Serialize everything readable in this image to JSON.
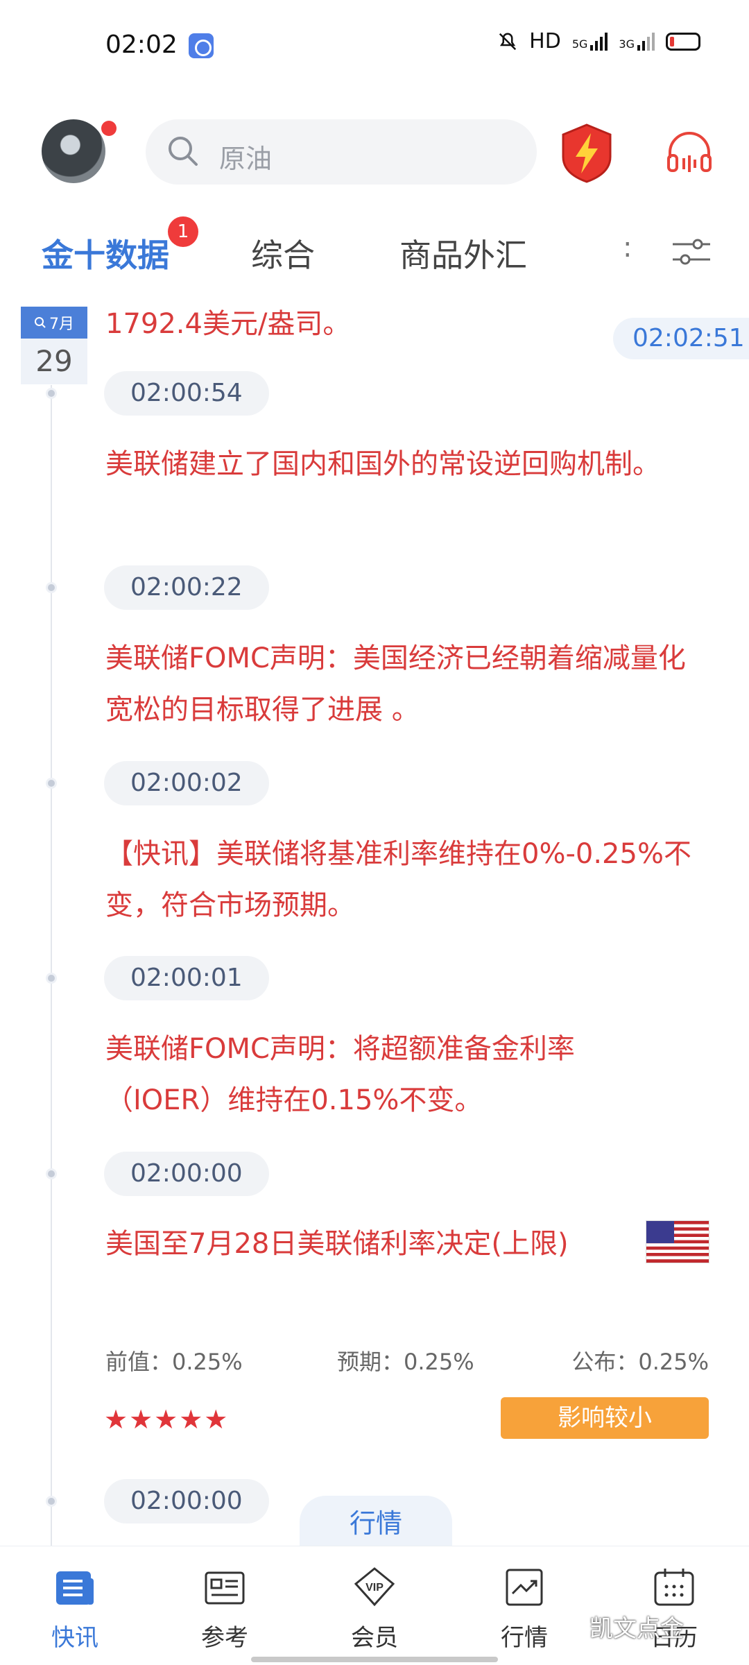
{
  "status_bar": {
    "time": "02:02",
    "network_text": "HD",
    "gen1": "5G",
    "gen2": "3G"
  },
  "header": {
    "search_placeholder": "原油"
  },
  "tabs": [
    {
      "label": "金十数据",
      "badge": "1"
    },
    {
      "label": "综合"
    },
    {
      "label": "商品外汇"
    }
  ],
  "tab_more": ":",
  "date": {
    "month": "7月",
    "day": "29"
  },
  "float_time": "02:02:51",
  "partial_text": "1792.4美元/盎司。",
  "feed": [
    {
      "time": "02:00:54",
      "text": "美联储建立了国内和国外的常设逆回购机制。"
    },
    {
      "time": "02:00:22",
      "text": "美联储FOMC声明：美国经济已经朝着缩减量化宽松的目标取得了进展 。"
    },
    {
      "time": "02:00:02",
      "text": "【快讯】美联储将基准利率维持在0%-0.25%不变，符合市场预期。"
    },
    {
      "time": "02:00:01",
      "text": "美联储FOMC声明：将超额准备金利率（IOER）维持在0.15%不变。"
    },
    {
      "time": "02:00:00",
      "text": "美国至7月28日美联储利率决定(上限)",
      "flag": "us-flag",
      "previous": "前值：0.25%",
      "forecast": "预期：0.25%",
      "actual": "公布：0.25%",
      "stars": "★★★★★",
      "star_rating": 5,
      "impact": "影响较小"
    },
    {
      "time": "02:00:00"
    }
  ],
  "float_button": "行情",
  "bottom_nav": [
    {
      "label": "快讯",
      "icon": "news-icon",
      "active": true
    },
    {
      "label": "参考",
      "icon": "reference-icon"
    },
    {
      "label": "会员",
      "icon": "vip-icon"
    },
    {
      "label": "行情",
      "icon": "market-icon"
    },
    {
      "label": "日历",
      "icon": "calendar-icon"
    }
  ],
  "watermark": "凯文点金",
  "colors": {
    "accent": "#3a78d8",
    "news_red": "#d93b3b",
    "impact_orange": "#f7a23a",
    "badge_red": "#ef3b3b"
  }
}
